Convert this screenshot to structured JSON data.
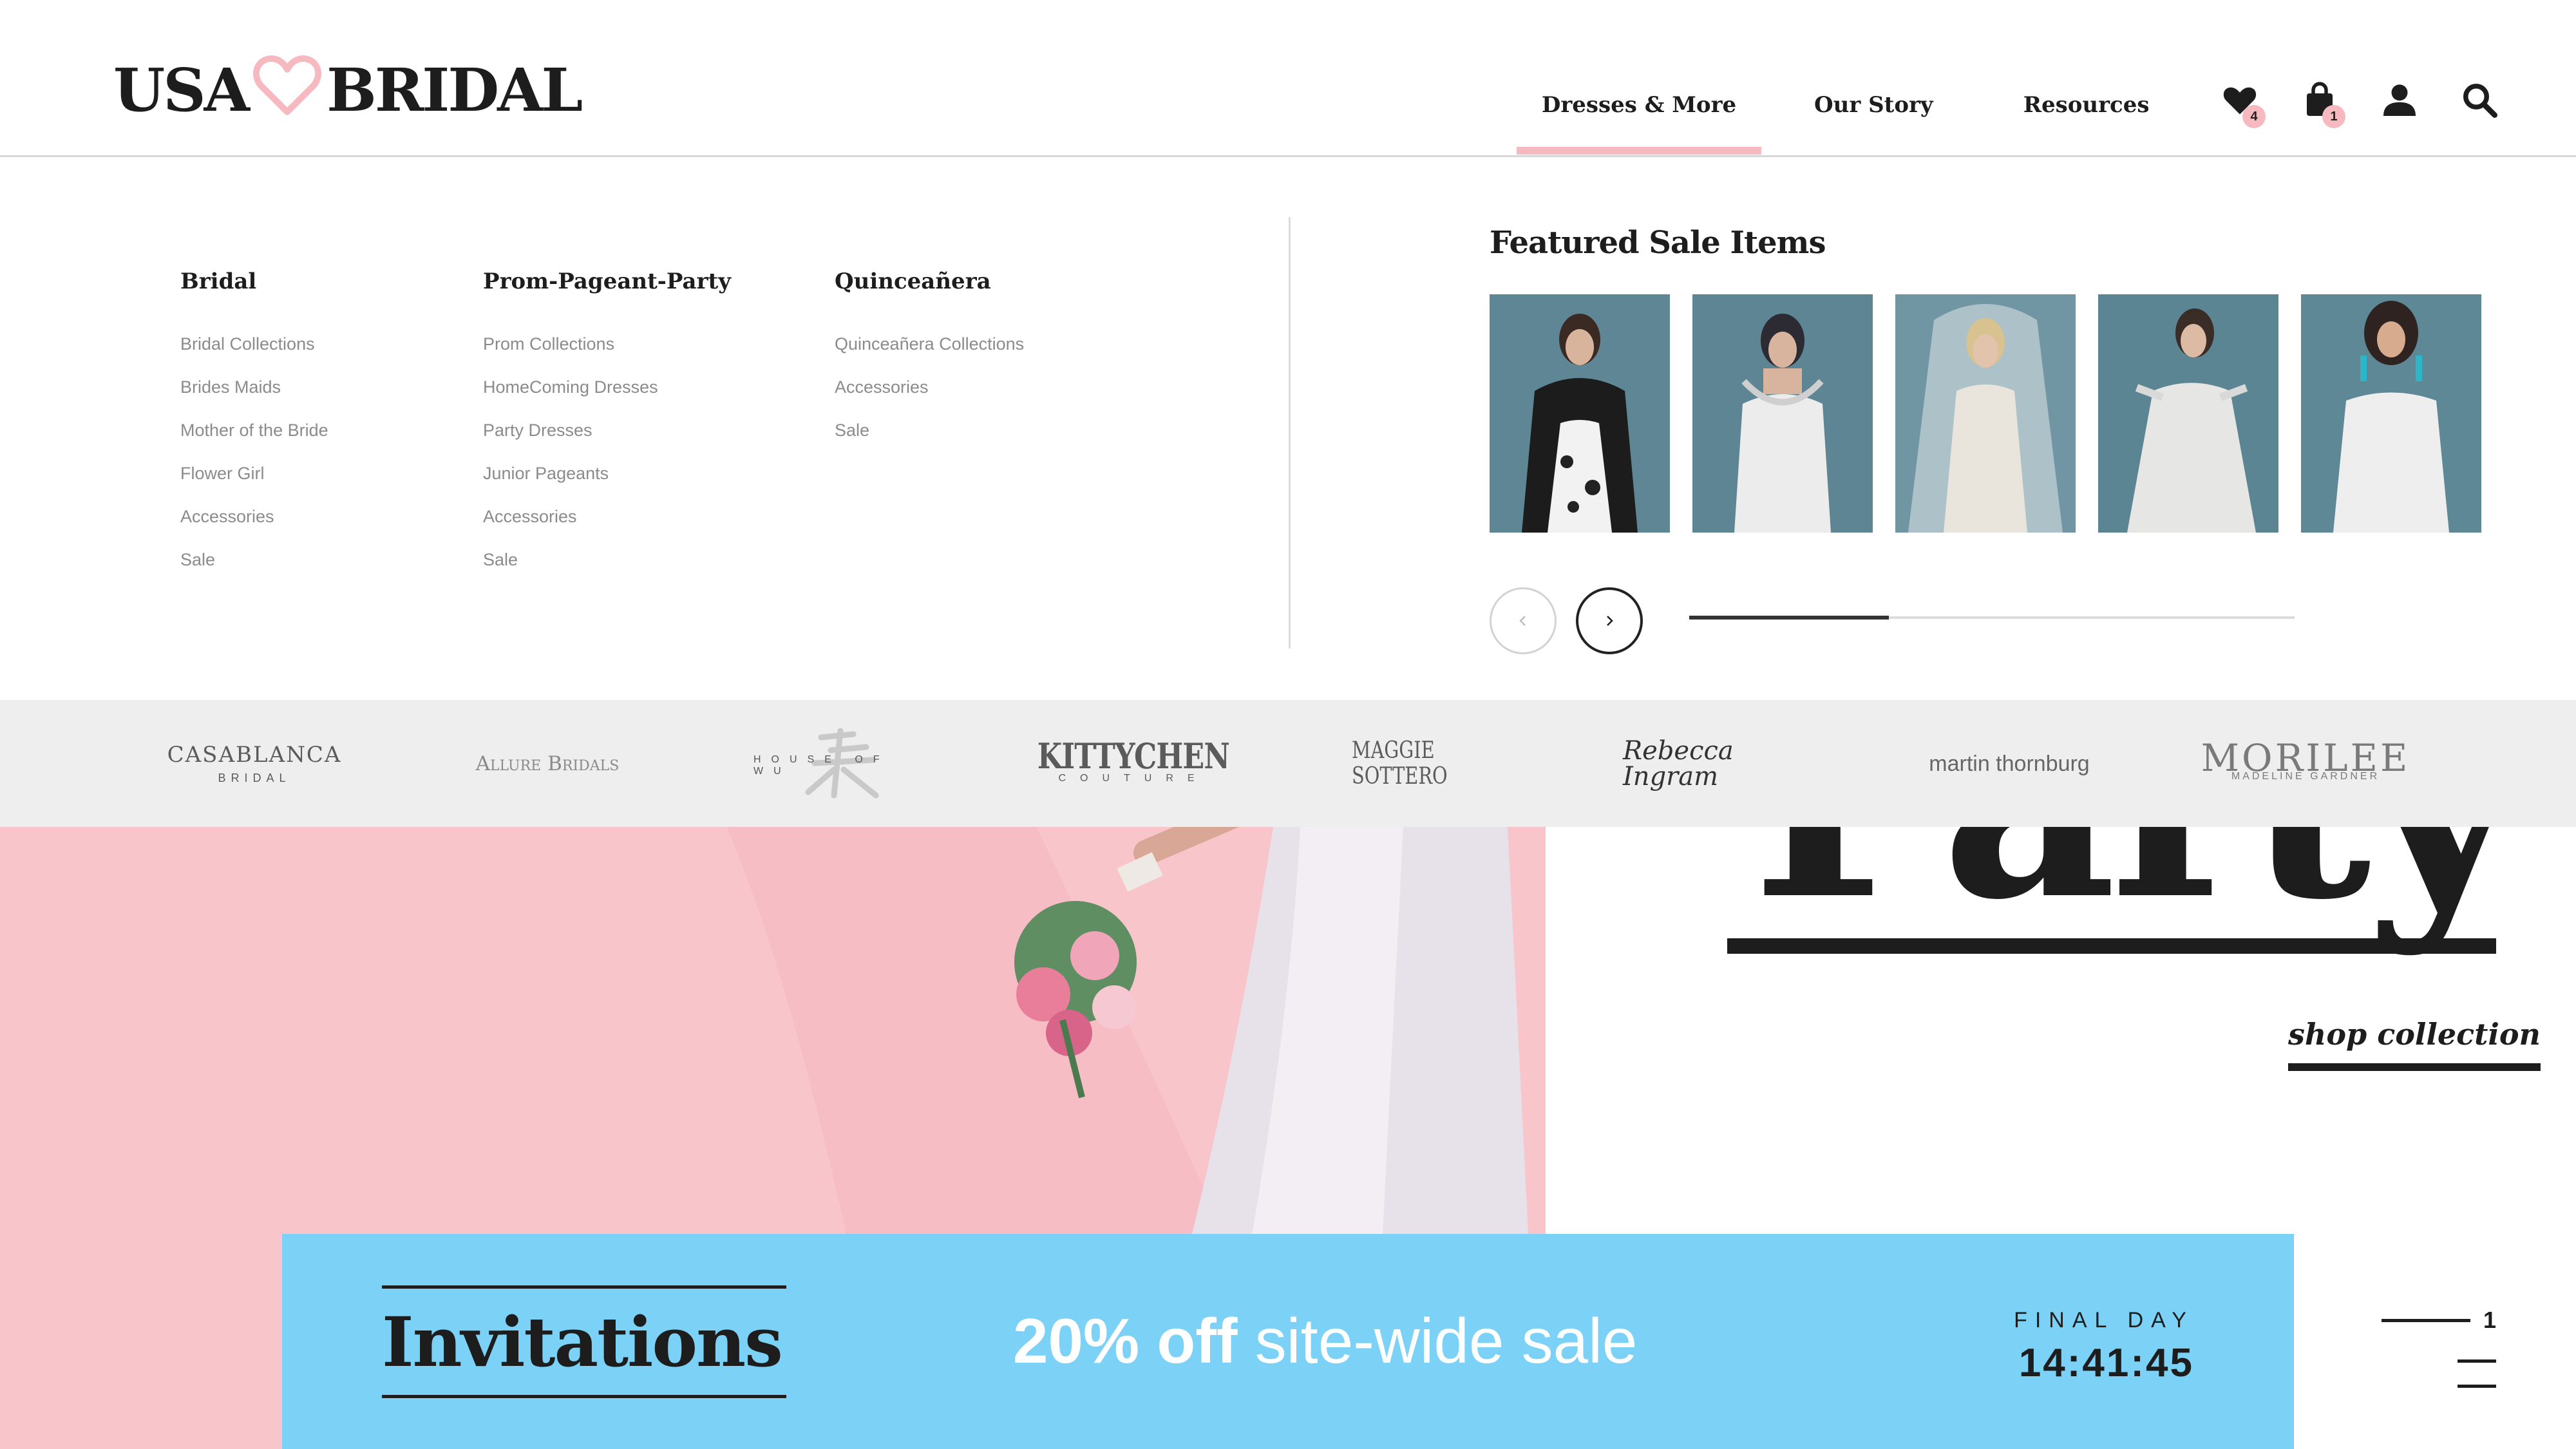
{
  "header": {
    "logo": {
      "left": "USA",
      "right": "BRIDAL"
    },
    "nav": [
      {
        "label": "Dresses & More",
        "active": true
      },
      {
        "label": "Our Story",
        "active": false
      },
      {
        "label": "Resources",
        "active": false
      }
    ],
    "icons": {
      "wishlist": {
        "name": "heart-icon",
        "count": "4"
      },
      "cart": {
        "name": "shopping-bag-icon",
        "count": "1"
      },
      "account": {
        "name": "user-icon"
      },
      "search": {
        "name": "search-icon"
      }
    }
  },
  "mega_menu": {
    "columns": [
      {
        "title": "Bridal",
        "links": [
          "Bridal Collections",
          "Brides Maids",
          "Mother of the Bride",
          "Flower Girl",
          "Accessories",
          "Sale"
        ]
      },
      {
        "title": "Prom-Pageant-Party",
        "links": [
          "Prom Collections",
          "HomeComing Dresses",
          "Party Dresses",
          "Junior Pageants",
          "Accessories",
          "Sale"
        ]
      },
      {
        "title": "Quinceañera",
        "links": [
          "Quinceañera Collections",
          "Accessories",
          "Sale"
        ]
      }
    ],
    "featured": {
      "title": "Featured Sale Items",
      "item_count": 5,
      "progress": 0.33
    }
  },
  "brands": [
    {
      "name": "CASABLANCA",
      "sub": "BRIDAL"
    },
    {
      "name": "Allure Bridals",
      "sub": ""
    },
    {
      "name": "",
      "sub": "HOUSE OF WU"
    },
    {
      "name": "KITTYCHEN",
      "sub": "COUTURE"
    },
    {
      "name": "MAGGIE SOTTERO",
      "sub": ""
    },
    {
      "name": "Rebecca Ingram",
      "sub": ""
    },
    {
      "name": "martin thornburg",
      "sub": ""
    },
    {
      "name": "MORILEE",
      "sub": "MADELINE GARDNER"
    }
  ],
  "hero": {
    "headline": "Party",
    "cta": "shop collection",
    "slide": "1"
  },
  "promo": {
    "title": "Invitations",
    "sale_bold": "20% off",
    "sale_light": " site-wide sale",
    "final_label": "FINAL DAY",
    "countdown": "14:41:45"
  },
  "colors": {
    "accent_pink": "#f6b9bf",
    "promo_blue": "#7bd2f6",
    "hero_pink": "#f8c5ca",
    "text_dark": "#1d1d1d"
  }
}
